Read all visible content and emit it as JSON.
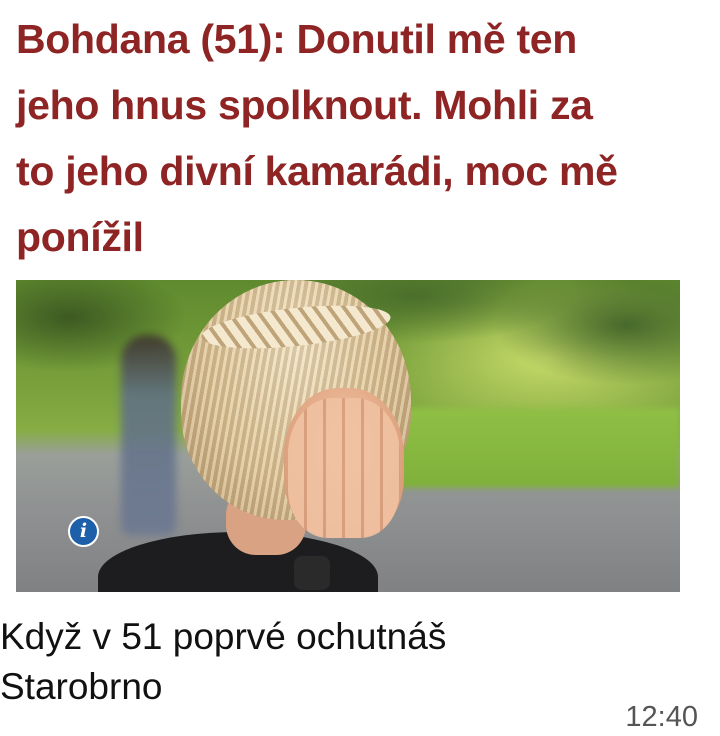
{
  "article": {
    "headline_lines": [
      "Bohdana (51): Donutil mě ten",
      "jeho hnus spolknout. Mohli za",
      "to jeho divní kamarádi, moc mě",
      "ponížil"
    ],
    "info_icon": "info-icon",
    "info_glyph": "i"
  },
  "message": {
    "caption_lines": [
      "Když v 51 poprvé ochutnáš",
      "Starobrno"
    ],
    "time": "12:40"
  },
  "colors": {
    "headline": "#8e2424",
    "caption": "#111111",
    "time": "#555555",
    "info_badge": "#1d5fa8"
  }
}
